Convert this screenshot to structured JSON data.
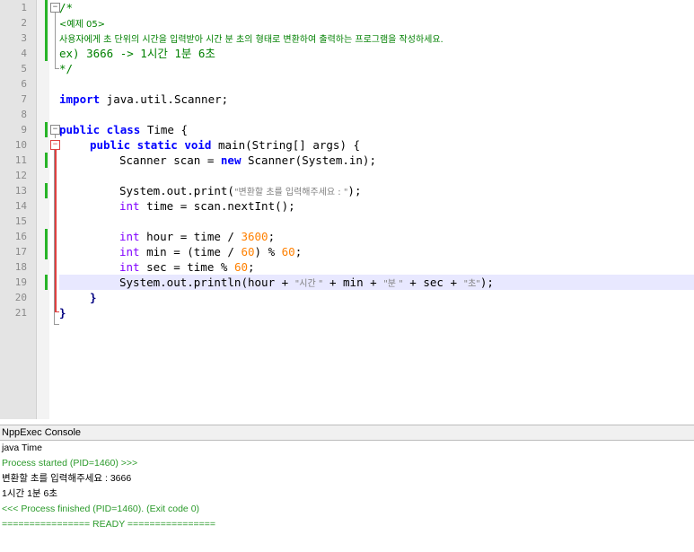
{
  "editor": {
    "line_numbers": [
      "1",
      "2",
      "3",
      "4",
      "5",
      "6",
      "7",
      "8",
      "9",
      "10",
      "11",
      "12",
      "13",
      "14",
      "15",
      "16",
      "17",
      "18",
      "19",
      "20",
      "21"
    ],
    "comment": {
      "open": "/*",
      "example_title": "<예제 05>",
      "task": "사용자에게 초 단위의 시간을 입력받아 시간 분 초의 형태로 변환하여 출력하는 프로그램을 작성하세요.",
      "example_io": "ex) 3666 -> 1시간 1분 6초",
      "close": "*/"
    },
    "code": {
      "import_kw": "import",
      "import_path": " java.util.Scanner;",
      "class_kw": "public class",
      "class_name": " Time {",
      "main_kw": "public static void",
      "main_sig": " main(String[] args) {",
      "scanner_decl": "Scanner scan = ",
      "new_kw": "new",
      "scanner_ctor": " Scanner(System.in);",
      "print_call": "System.out.print(",
      "prompt_str": "\"변환할 초를 입력해주세요 : \"",
      "print_end": ");",
      "int_kw": "int",
      "time_decl": " time = scan.nextInt();",
      "hour_decl": " hour = time / ",
      "hour_num": "3600",
      "min_decl_a": " min = (time / ",
      "min_num_a": "60",
      "min_decl_b": ") % ",
      "min_num_b": "60",
      "sec_decl": " sec = time % ",
      "sec_num": "60",
      "semi": ";",
      "println_a": "System.out.println(hour + ",
      "str_hour": "\"시간 \"",
      "plus_min": " + min + ",
      "str_min": "\"분 \"",
      "plus_sec": " + sec + ",
      "str_sec": "\"초\"",
      "println_end": ");",
      "close_brace": "}"
    }
  },
  "console": {
    "title": "NppExec Console",
    "lines": [
      {
        "text": "java Time",
        "color": "#000000"
      },
      {
        "text": "Process started (PID=1460) >>>",
        "color": "#2a9a2a"
      },
      {
        "text": "변환할 초를 입력해주세요 : 3666",
        "color": "#000000"
      },
      {
        "text": "1시간 1분 6초",
        "color": "#000000"
      },
      {
        "text": "<<< Process finished (PID=1460). (Exit code 0)",
        "color": "#2a9a2a"
      },
      {
        "text": "================ READY ================",
        "color": "#2a9a2a"
      }
    ]
  }
}
